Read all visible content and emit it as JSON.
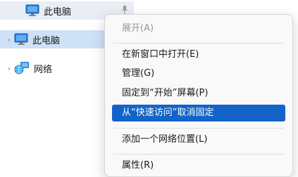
{
  "nav": {
    "pinned_item": {
      "label": "此电脑",
      "icon": "monitor-icon"
    },
    "this_pc": {
      "label": "此电脑",
      "icon": "monitor-icon"
    },
    "network": {
      "label": "网络",
      "icon": "network-icon"
    }
  },
  "context_menu": {
    "items": [
      {
        "label": "展开(A)",
        "state": "disabled"
      },
      {
        "label": "在新窗口中打开(E)",
        "state": "normal"
      },
      {
        "label": "管理(G)",
        "state": "normal"
      },
      {
        "label": "固定到“开始”屏幕(P)",
        "state": "normal"
      },
      {
        "label": "从“快速访问”取消固定",
        "state": "highlighted"
      },
      {
        "label": "添加一个网络位置(L)",
        "state": "normal"
      },
      {
        "label": "属性(R)",
        "state": "normal"
      }
    ]
  },
  "colors": {
    "highlight": "#1363c8",
    "selected_row": "#cfe1f7",
    "menu_background": "#f9f9f9",
    "disabled_text": "#9a9a9a"
  }
}
